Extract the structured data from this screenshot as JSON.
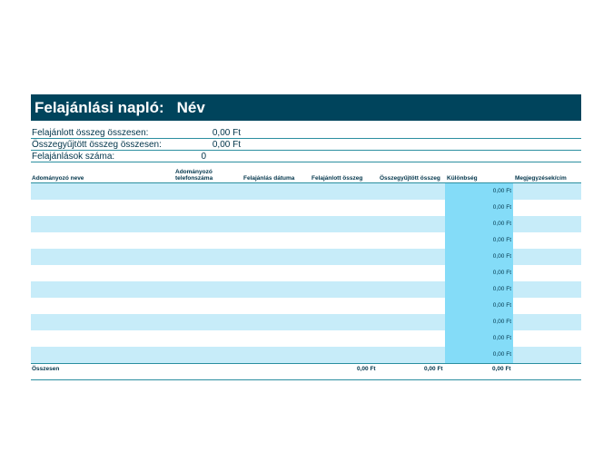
{
  "banner": {
    "title": "Felajánlási napló:",
    "name": "Név"
  },
  "summary": [
    {
      "label": "Felajánlott összeg összesen:",
      "value": "0,00 Ft"
    },
    {
      "label": "Összegyűjtött összeg összesen:",
      "value": "0,00 Ft"
    },
    {
      "label": "Felajánlások száma:",
      "value": "0"
    }
  ],
  "table": {
    "headers": {
      "donor": "Adományozó neve",
      "phone": "Adományozó telefonszáma",
      "date": "Felajánlás dátuma",
      "offered": "Felajánlott összeg",
      "collected": "Összegyűjtött összeg",
      "difference": "Különbség",
      "notes": "Megjegyzések/cím"
    },
    "rows": [
      {
        "difference": "0,00 Ft"
      },
      {
        "difference": "0,00 Ft"
      },
      {
        "difference": "0,00 Ft"
      },
      {
        "difference": "0,00 Ft"
      },
      {
        "difference": "0,00 Ft"
      },
      {
        "difference": "0,00 Ft"
      },
      {
        "difference": "0,00 Ft"
      },
      {
        "difference": "0,00 Ft"
      },
      {
        "difference": "0,00 Ft"
      },
      {
        "difference": "0,00 Ft"
      },
      {
        "difference": "0,00 Ft"
      }
    ],
    "total": {
      "label": "Összesen",
      "offered": "0,00 Ft",
      "collected": "0,00 Ft",
      "difference": "0,00 Ft"
    }
  },
  "colors": {
    "banner": "#00445c",
    "row_alt": "#c7ecf9",
    "difference_column": "#84dcf8"
  }
}
